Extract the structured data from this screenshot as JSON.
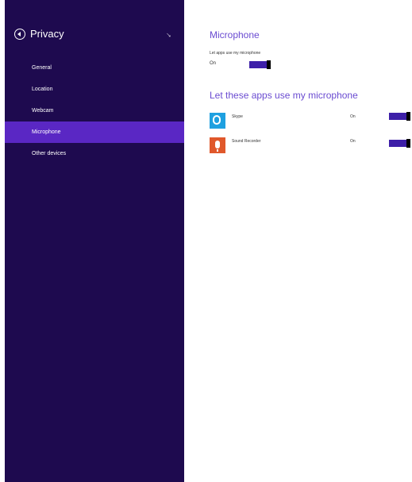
{
  "sidebar": {
    "title": "Privacy",
    "items": [
      {
        "label": "General"
      },
      {
        "label": "Location"
      },
      {
        "label": "Webcam"
      },
      {
        "label": "Microphone",
        "selected": true
      },
      {
        "label": "Other devices"
      }
    ]
  },
  "main": {
    "title": "Microphone",
    "master_label": "Let apps use my microphone",
    "master_state": "On",
    "section_title": "Let these apps use my microphone",
    "apps": [
      {
        "name": "Skype",
        "state": "On",
        "icon": "skype-icon"
      },
      {
        "name": "Sound Recorder",
        "state": "On",
        "icon": "microphone-icon"
      }
    ]
  },
  "colors": {
    "sidebar_bg": "#1e0a4f",
    "accent": "#5a27c4",
    "heading": "#6a4bd1",
    "toggle_on": "#3d1fa8"
  }
}
